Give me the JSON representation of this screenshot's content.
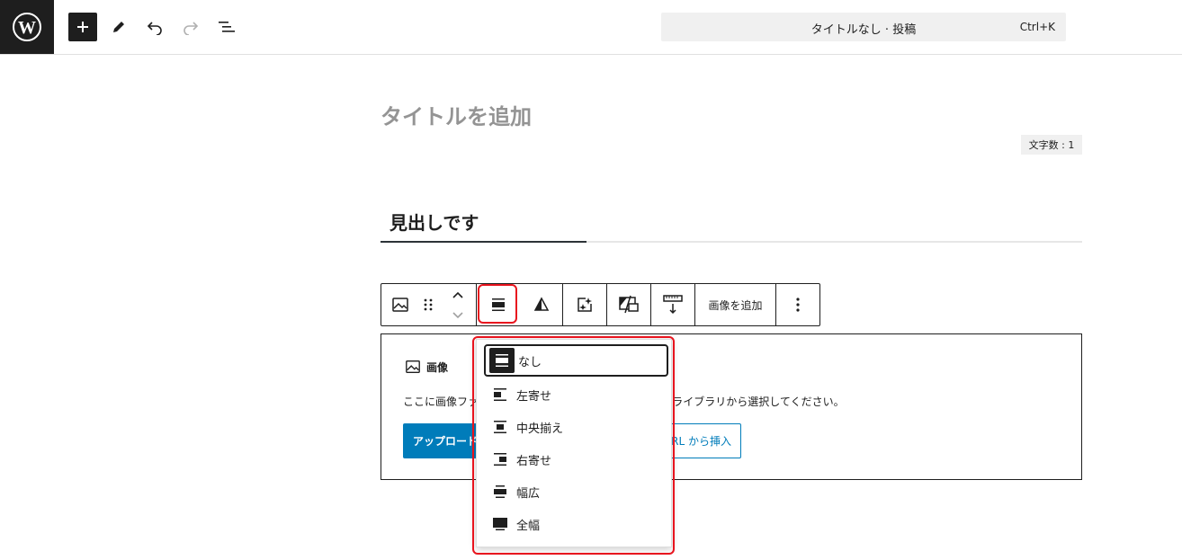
{
  "topbar": {
    "logo_icon": "wordpress-icon",
    "add_icon": "plus-icon",
    "tools_icon": "pencil-icon",
    "undo_icon": "undo-icon",
    "redo_icon": "redo-icon",
    "list_view_icon": "list-view-icon",
    "command_title": "タイトルなし · 投稿",
    "command_shortcut": "Ctrl+K"
  },
  "editor": {
    "title_placeholder": "タイトルを追加",
    "word_count": "文字数 : 1",
    "heading_text": "見出しです"
  },
  "block_toolbar": {
    "image_icon": "image-icon",
    "drag_icon": "drag-handle-icon",
    "move_up_icon": "chevron-up-icon",
    "move_down_icon": "chevron-down-icon",
    "align_icon": "align-none-icon",
    "duotone_icon": "duotone-icon",
    "ai_icon": "image-sparkle-icon",
    "aspect_icon": "aspect-ratio-icon",
    "resize_icon": "height-resize-icon",
    "add_image_label": "画像を追加",
    "more_icon": "more-vertical-icon"
  },
  "placeholder": {
    "label": "画像",
    "instructions": "ここに画像ファイルをアップロード、ドラッグするか、ライブラリから選択してください。",
    "upload_label": "アップロード",
    "url_label": "URL から挿入"
  },
  "align_menu": {
    "items": [
      {
        "label": "なし",
        "icon": "align-none-icon",
        "selected": true
      },
      {
        "label": "左寄せ",
        "icon": "align-left-icon",
        "selected": false
      },
      {
        "label": "中央揃え",
        "icon": "align-center-icon",
        "selected": false
      },
      {
        "label": "右寄せ",
        "icon": "align-right-icon",
        "selected": false
      },
      {
        "label": "幅広",
        "icon": "align-wide-icon",
        "selected": false
      },
      {
        "label": "全幅",
        "icon": "align-full-icon",
        "selected": false
      }
    ]
  },
  "colors": {
    "accent": "#007cba",
    "highlight": "#e8141e",
    "dark": "#1e1e1e"
  }
}
